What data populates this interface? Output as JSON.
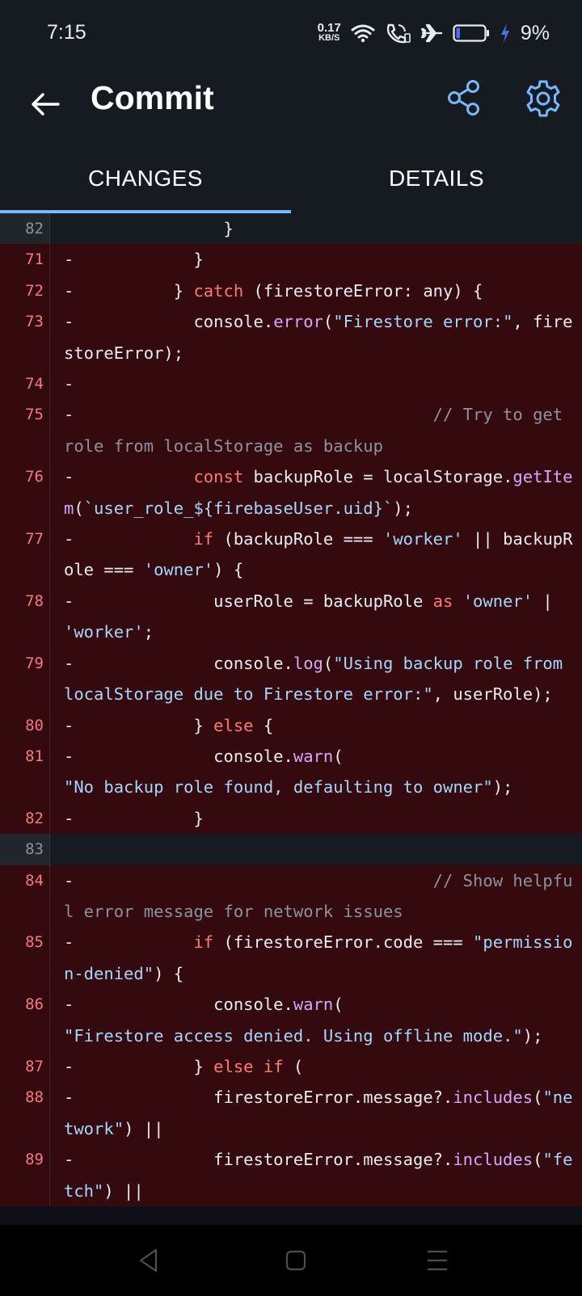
{
  "status_bar": {
    "time": "7:15",
    "net_speed_value": "0.17",
    "net_speed_unit": "KB/S",
    "battery_percent": "9%",
    "icons": [
      "wifi-icon",
      "call-icon",
      "airplane-icon",
      "battery-icon",
      "charging-icon"
    ]
  },
  "header": {
    "title": "Commit",
    "icons": [
      "back-arrow-icon",
      "share-icon",
      "gear-icon"
    ],
    "accent_color": "#79b8ff"
  },
  "tabs": [
    {
      "label": "CHANGES",
      "active": true
    },
    {
      "label": "DETAILS",
      "active": false
    }
  ],
  "diff": {
    "colors": {
      "deleted_bg": "#340a0f",
      "context_bg": "#161b22",
      "keyword": "#ff7b72",
      "string": "#a5d6ff",
      "function": "#d2a8ff",
      "comment": "#8b949e"
    },
    "lines": [
      {
        "num": "82",
        "kind": "ctx",
        "tokens": [
          [
            "",
            "                }"
          ]
        ]
      },
      {
        "num": "71",
        "kind": "del",
        "tokens": [
          [
            "",
            "-            }"
          ]
        ]
      },
      {
        "num": "72",
        "kind": "del",
        "tokens": [
          [
            "",
            "-          } "
          ],
          [
            "kw",
            "catch"
          ],
          [
            "",
            " (firestoreError: any) {"
          ]
        ]
      },
      {
        "num": "73",
        "kind": "del",
        "tokens": [
          [
            "",
            "-            console."
          ],
          [
            "fn",
            "error"
          ],
          [
            "",
            "("
          ],
          [
            "str",
            "\"Firestore error:\""
          ],
          [
            "",
            ", firestoreError);"
          ]
        ]
      },
      {
        "num": "74",
        "kind": "del",
        "tokens": [
          [
            "",
            "-"
          ]
        ]
      },
      {
        "num": "75",
        "kind": "del",
        "tokens": [
          [
            "",
            "-                                    "
          ],
          [
            "cm",
            "// Try to get role from localStorage as backup"
          ]
        ]
      },
      {
        "num": "76",
        "kind": "del",
        "tokens": [
          [
            "",
            "-            "
          ],
          [
            "kw",
            "const"
          ],
          [
            "",
            " backupRole = localStorage."
          ],
          [
            "fn",
            "getItem"
          ],
          [
            "",
            "("
          ],
          [
            "str",
            "`user_role_${firebaseUser.uid}`"
          ],
          [
            "",
            ");"
          ]
        ]
      },
      {
        "num": "77",
        "kind": "del",
        "tokens": [
          [
            "",
            "-            "
          ],
          [
            "kw",
            "if"
          ],
          [
            "",
            " (backupRole === "
          ],
          [
            "str",
            "'worker'"
          ],
          [
            "",
            " || backupRole === "
          ],
          [
            "str",
            "'owner'"
          ],
          [
            "",
            ") {"
          ]
        ]
      },
      {
        "num": "78",
        "kind": "del",
        "tokens": [
          [
            "",
            "-              userRole = backupRole "
          ],
          [
            "kw",
            "as"
          ],
          [
            "",
            " "
          ],
          [
            "str",
            "'owner'"
          ],
          [
            "",
            " | "
          ],
          [
            "str",
            "'worker'"
          ],
          [
            "",
            ";"
          ]
        ]
      },
      {
        "num": "79",
        "kind": "del",
        "tokens": [
          [
            "",
            "-              console."
          ],
          [
            "fn",
            "log"
          ],
          [
            "",
            "("
          ],
          [
            "str",
            "\"Using backup role from localStorage due to Firestore error:\""
          ],
          [
            "",
            ", userRole);"
          ]
        ]
      },
      {
        "num": "80",
        "kind": "del",
        "tokens": [
          [
            "",
            "-            } "
          ],
          [
            "kw",
            "else"
          ],
          [
            "",
            " {"
          ]
        ]
      },
      {
        "num": "81",
        "kind": "del",
        "tokens": [
          [
            "",
            "-              console."
          ],
          [
            "fn",
            "warn"
          ],
          [
            "",
            "(                       "
          ],
          [
            "str",
            "\"No backup role found, defaulting to owner\""
          ],
          [
            "",
            ");"
          ]
        ]
      },
      {
        "num": "82",
        "kind": "del",
        "tokens": [
          [
            "",
            "-            }"
          ]
        ]
      },
      {
        "num": "83",
        "kind": "ctx",
        "tokens": [
          [
            "",
            ""
          ]
        ]
      },
      {
        "num": "84",
        "kind": "del",
        "tokens": [
          [
            "",
            "-                                    "
          ],
          [
            "cm",
            "// Show helpful error message for network issues"
          ]
        ]
      },
      {
        "num": "85",
        "kind": "del",
        "tokens": [
          [
            "",
            "-            "
          ],
          [
            "kw",
            "if"
          ],
          [
            "",
            " (firestoreError.code === "
          ],
          [
            "str",
            "\"permission-denied\""
          ],
          [
            "",
            ") {"
          ]
        ]
      },
      {
        "num": "86",
        "kind": "del",
        "tokens": [
          [
            "",
            "-              console."
          ],
          [
            "fn",
            "warn"
          ],
          [
            "",
            "(                       "
          ],
          [
            "str",
            "\"Firestore access denied. Using offline mode.\""
          ],
          [
            "",
            ");"
          ]
        ]
      },
      {
        "num": "87",
        "kind": "del",
        "tokens": [
          [
            "",
            "-            } "
          ],
          [
            "kw",
            "else if"
          ],
          [
            "",
            " ("
          ]
        ]
      },
      {
        "num": "88",
        "kind": "del",
        "tokens": [
          [
            "",
            "-              firestoreError.message?."
          ],
          [
            "fn",
            "includes"
          ],
          [
            "",
            "("
          ],
          [
            "str",
            "\"network\""
          ],
          [
            "",
            ") ||"
          ]
        ]
      },
      {
        "num": "89",
        "kind": "del",
        "tokens": [
          [
            "",
            "-              firestoreError.message?."
          ],
          [
            "fn",
            "includes"
          ],
          [
            "",
            "("
          ],
          [
            "str",
            "\"fetch\""
          ],
          [
            "",
            ") ||"
          ]
        ]
      }
    ]
  },
  "nav_bar": {
    "icons": [
      "nav-back-icon",
      "nav-home-icon",
      "nav-menu-icon"
    ]
  }
}
